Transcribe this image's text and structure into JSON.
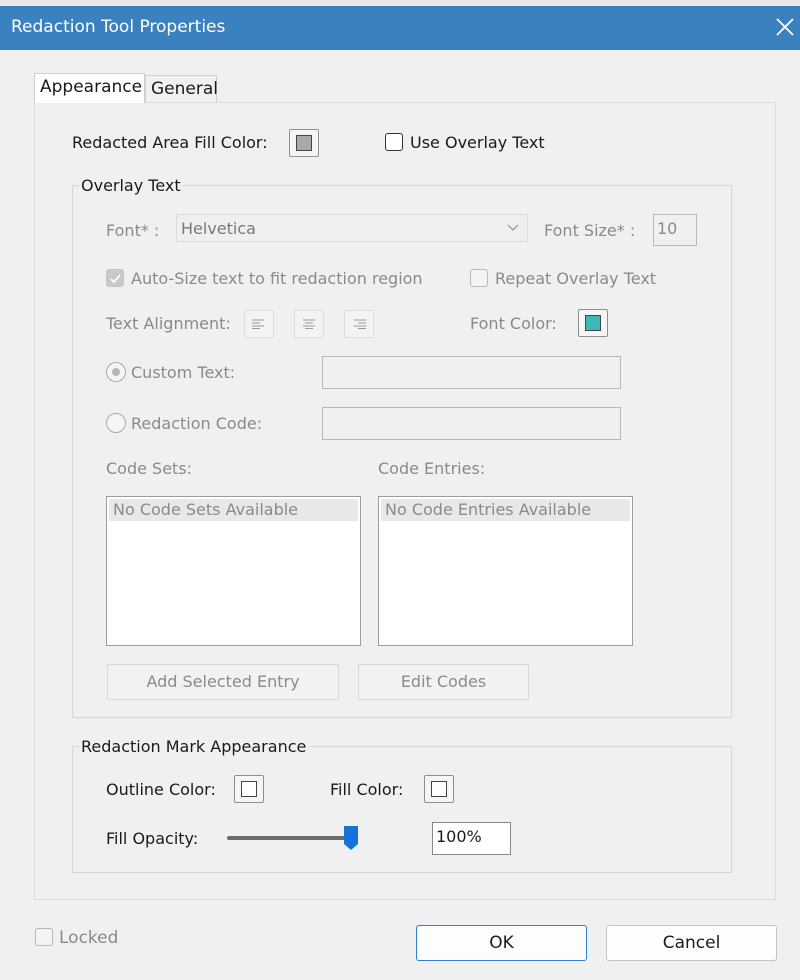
{
  "window": {
    "title": "Redaction Tool Properties",
    "close_icon": "close-icon"
  },
  "tabs": [
    {
      "label": "Appearance",
      "active": true
    },
    {
      "label": "General",
      "active": false
    }
  ],
  "fill": {
    "label": "Redacted Area Fill Color:",
    "color": "#a9a9a9"
  },
  "use_overlay": {
    "label": "Use Overlay Text",
    "checked": false
  },
  "overlay": {
    "legend": "Overlay Text",
    "font_label": "Font* :",
    "font_value": "Helvetica",
    "font_size_label": "Font Size* :",
    "font_size_value": "10",
    "autosize_label": "Auto-Size text to fit redaction region",
    "autosize_checked": true,
    "repeat_label": "Repeat Overlay Text",
    "repeat_checked": false,
    "alignment_label": "Text Alignment:",
    "alignment_icons": [
      "align-left-icon",
      "align-center-icon",
      "align-right-icon"
    ],
    "font_color_label": "Font Color:",
    "font_color": "#3cb8b8",
    "custom_text_label": "Custom Text:",
    "custom_text_selected": true,
    "redaction_code_label": "Redaction Code:",
    "code_sets_label": "Code Sets:",
    "code_sets_item": "No Code Sets Available",
    "code_entries_label": "Code Entries:",
    "code_entries_item": "No Code Entries Available",
    "add_entry_button": "Add Selected Entry",
    "edit_codes_button": "Edit Codes"
  },
  "mark": {
    "legend": "Redaction Mark Appearance",
    "outline_label": "Outline Color:",
    "outline_color": "#ffffff",
    "fill_label": "Fill Color:",
    "fill_color": "#ffffff",
    "opacity_label": "Fill Opacity:",
    "opacity_value": "100%",
    "opacity_level": 1.0
  },
  "footer": {
    "locked_label": "Locked",
    "locked_checked": false,
    "ok": "OK",
    "cancel": "Cancel"
  },
  "colors": {
    "titlebar": "#3b80bf",
    "accent": "#1672d6"
  }
}
